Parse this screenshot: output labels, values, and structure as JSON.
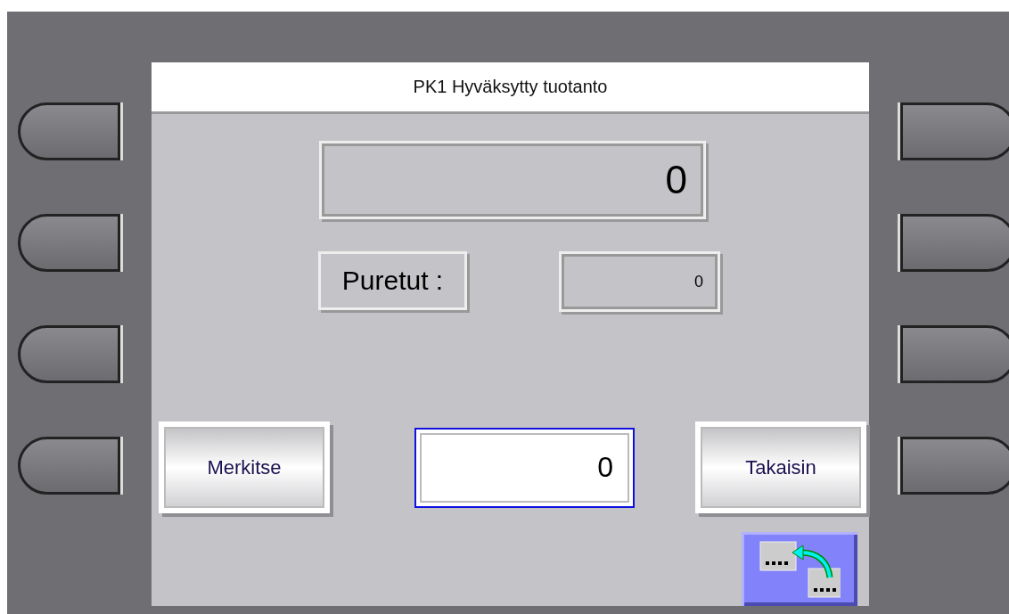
{
  "title": "PK1 Hyväksytty tuotanto",
  "main_display": {
    "value": "0"
  },
  "puretut": {
    "label": "Puretut :",
    "value": "0"
  },
  "buttons": [
    {
      "label": "Merkitse"
    },
    {
      "label": "Takaisin"
    }
  ],
  "input": {
    "value": "0",
    "focused": true
  }
}
